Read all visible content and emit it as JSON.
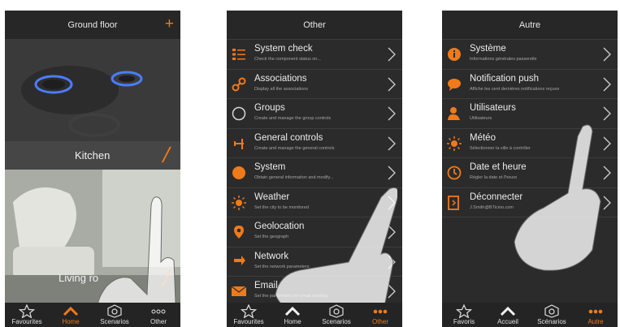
{
  "screens": [
    {
      "title": "Ground floor",
      "add_icon": "plus-icon",
      "rooms": [
        {
          "name": "Kitchen"
        },
        {
          "name": "Living ro"
        }
      ],
      "tabs": [
        {
          "label": "Favourites",
          "icon": "star-icon",
          "active": false
        },
        {
          "label": "Home",
          "icon": "home-icon",
          "active": true
        },
        {
          "label": "Scenarios",
          "icon": "scenario-icon",
          "active": false
        },
        {
          "label": "Other",
          "icon": "more-icon",
          "active": false
        }
      ]
    },
    {
      "title": "Other",
      "items": [
        {
          "label": "System check",
          "sub": "Check the component status on...",
          "icon": "list-icon"
        },
        {
          "label": "Associations",
          "sub": "Display all the associations",
          "icon": "link-icon"
        },
        {
          "label": "Groups",
          "sub": "Create and manage the group controls",
          "icon": "circle-icon"
        },
        {
          "label": "General controls",
          "sub": "Create and manage the general controls",
          "icon": "controls-icon"
        },
        {
          "label": "System",
          "sub": "Obtain general information and modify...",
          "icon": "info-icon"
        },
        {
          "label": "Weather",
          "sub": "Set the city to be monitored",
          "icon": "sun-icon"
        },
        {
          "label": "Geolocation",
          "sub": "Set the geograph",
          "icon": "pin-icon"
        },
        {
          "label": "Network",
          "sub": "Set the network parameters",
          "icon": "network-icon"
        },
        {
          "label": "Email",
          "sub": "Set the parameters for email sending",
          "icon": "mail-icon"
        }
      ],
      "tabs": [
        {
          "label": "Favourites",
          "icon": "star-icon",
          "active": false
        },
        {
          "label": "Home",
          "icon": "home-icon",
          "active": false
        },
        {
          "label": "Scenarios",
          "icon": "scenario-icon",
          "active": false
        },
        {
          "label": "Other",
          "icon": "more-icon",
          "active": true
        }
      ]
    },
    {
      "title": "Autre",
      "items": [
        {
          "label": "Système",
          "sub": "Informations générales passerelle",
          "icon": "info-icon"
        },
        {
          "label": "Notification push",
          "sub": "Affiche les cent dernières notifications reçues",
          "icon": "chat-icon"
        },
        {
          "label": "Utilisateurs",
          "sub": "Utilisateurs",
          "icon": "user-icon"
        },
        {
          "label": "Météo",
          "sub": "Sélectionner la ville à contrôler",
          "icon": "sun-icon"
        },
        {
          "label": "Date et heure",
          "sub": "Régler la date et l'heure",
          "icon": "clock-icon"
        },
        {
          "label": "Déconnecter",
          "sub": "J.Smith@BTicino.com",
          "icon": "logout-icon"
        }
      ],
      "tabs": [
        {
          "label": "Favoris",
          "icon": "star-icon",
          "active": false
        },
        {
          "label": "Accueil",
          "icon": "home-icon",
          "active": false
        },
        {
          "label": "Scénarios",
          "icon": "scenario-icon",
          "active": false
        },
        {
          "label": "Autre",
          "icon": "more-icon",
          "active": true
        }
      ]
    }
  ],
  "colors": {
    "accent": "#f07a1a",
    "background": "#2b2b2b",
    "text": "#ececec"
  }
}
